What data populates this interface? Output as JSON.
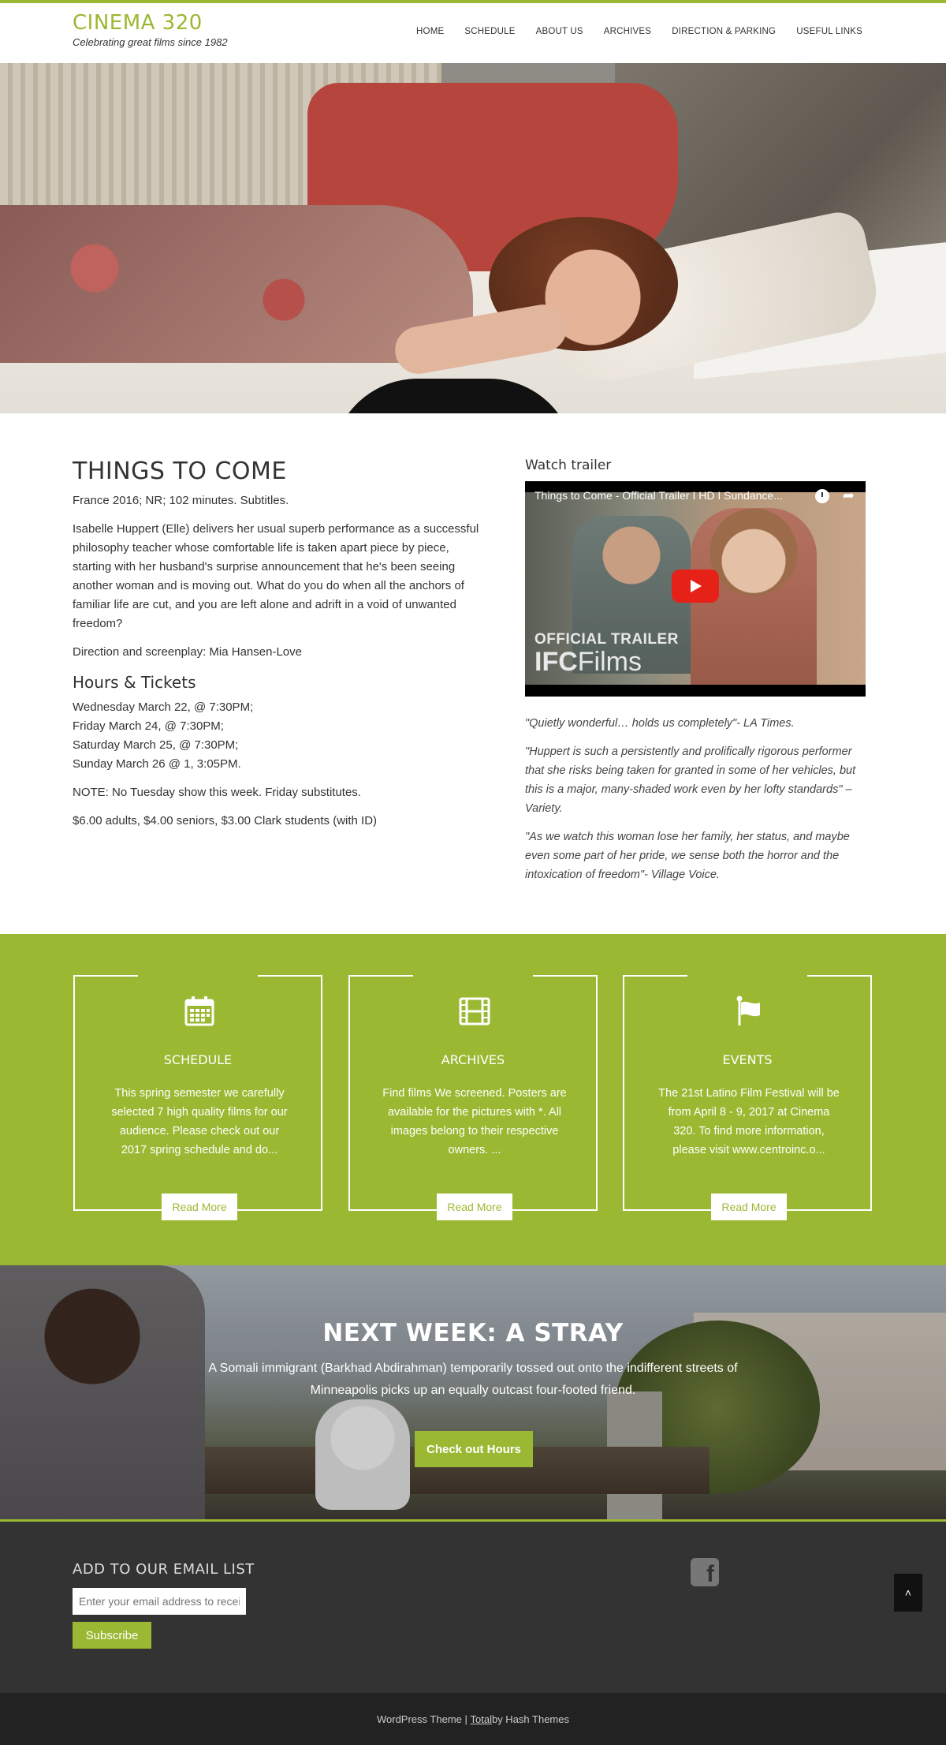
{
  "header": {
    "title": "CINEMA 320",
    "tagline": "Celebrating great films since 1982",
    "nav": [
      "HOME",
      "SCHEDULE",
      "ABOUT US",
      "ARCHIVES",
      "DIRECTION & PARKING",
      "USEFUL LINKS"
    ]
  },
  "accent_color": "#9bb832",
  "film": {
    "title": "THINGS TO COME",
    "info": "France 2016; NR; 102 minutes. Subtitles.",
    "synopsis": "Isabelle Huppert (Elle) delivers her usual superb performance as a successful philosophy teacher whose comfortable life is taken apart piece by piece, starting with her husband's surprise announcement that he's been seeing another woman and is moving out. What do you do when all the anchors of familiar life are cut, and you are left alone and adrift in a void of unwanted freedom?",
    "direction": "Direction and screenplay: Mia Hansen-Love",
    "hours_heading": "Hours & Tickets",
    "showtimes": [
      "Wednesday March 22, @ 7:30PM;",
      "Friday March 24, @ 7:30PM;",
      "Saturday March 25, @ 7:30PM;",
      "Sunday March 26 @ 1, 3:05PM."
    ],
    "note": "NOTE: No Tuesday show this week. Friday substitutes.",
    "prices": "$6.00 adults, $4.00 seniors, $3.00 Clark students (with ID)"
  },
  "trailer": {
    "heading": "Watch trailer",
    "video_title": "Things to Come - Official Trailer I HD I Sundance...",
    "overlay_line1": "OFFICIAL TRAILER",
    "overlay_brand": "IFC",
    "overlay_brand2": "Films",
    "quotes": [
      "\"Quietly wonderful… holds us completely\"- LA Times.",
      "\"Huppert is such a persistently and prolifically rigorous performer that she risks being taken for granted in some of her vehicles, but this is a major, many-shaded work even by her lofty standards\" – Variety.",
      "\"As we watch this woman lose her family, her status, and maybe even some part of her pride, we sense both the horror and the intoxication of freedom\"- Village Voice."
    ]
  },
  "cards": [
    {
      "title": "SCHEDULE",
      "text": "This spring semester we carefully selected 7 high quality films for our audience. Please check out our 2017 spring schedule and do...",
      "button": "Read More",
      "icon": "calendar-icon"
    },
    {
      "title": "ARCHIVES",
      "text": "Find films We screened. Posters are available for the pictures with *. All images belong to their respective owners.   ...",
      "button": "Read More",
      "icon": "film-icon"
    },
    {
      "title": "EVENTS",
      "text": "The 21st Latino Film Festival will be from April 8 - 9, 2017 at Cinema 320. To find more information, please visit www.centroinc.o...",
      "button": "Read More",
      "icon": "flag-icon"
    }
  ],
  "banner": {
    "title": "NEXT WEEK: A STRAY",
    "text": "A Somali immigrant (Barkhad Abdirahman) temporarily tossed out onto the indifferent streets of Minneapolis picks up an equally outcast four-footed friend.",
    "button": "Check out Hours"
  },
  "footer": {
    "heading": "ADD TO OUR EMAIL LIST",
    "email_placeholder": "Enter your email address to receive",
    "subscribe": "Subscribe",
    "facebook_letter": "f",
    "totop": "˄"
  },
  "credits": {
    "prefix": "WordPress Theme | ",
    "link": "Total",
    "suffix": " by Hash Themes"
  }
}
